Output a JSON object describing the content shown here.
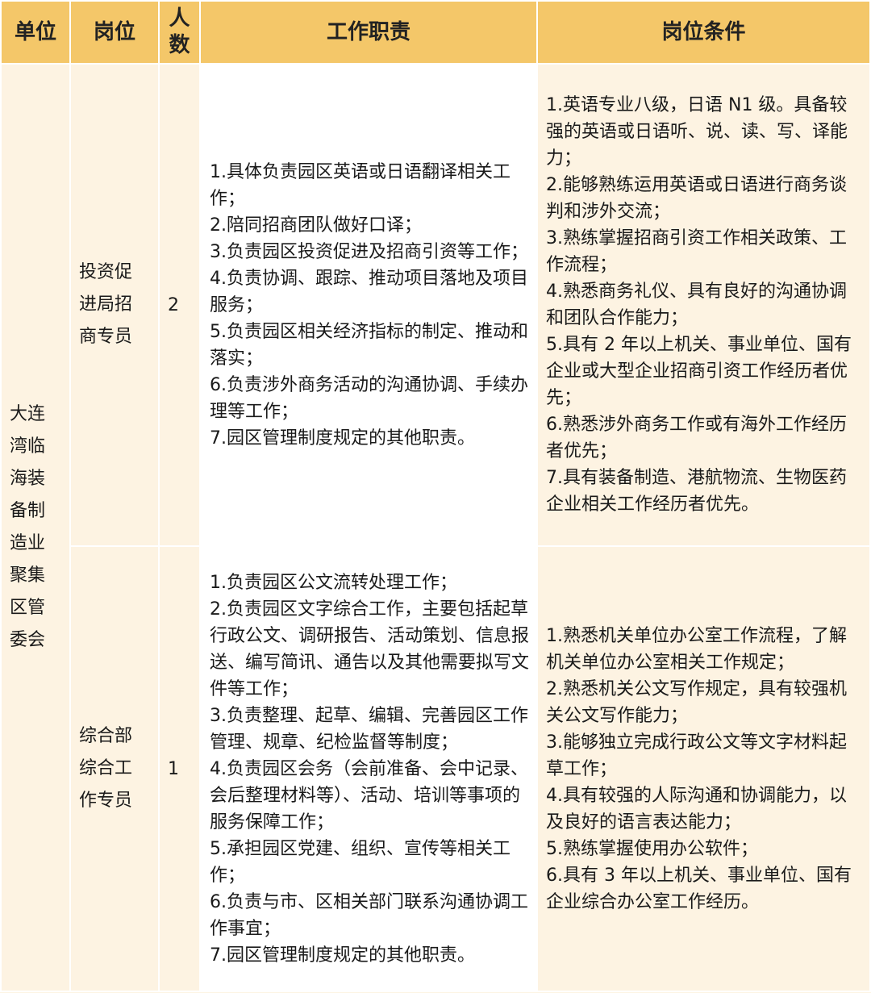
{
  "headers": {
    "unit": "单位",
    "post": "岗位",
    "count": "人数",
    "duties": "工作职责",
    "conditions": "岗位条件"
  },
  "unit": "大连湾临海装备制造业聚集区管委会",
  "rows": [
    {
      "post": "投资促进局招商专员",
      "count": "2",
      "duties": [
        "1.具体负责园区英语或日语翻译相关工作；",
        "2.陪同招商团队做好口译；",
        "3.负责园区投资促进及招商引资等工作；",
        "4.负责协调、跟踪、推动项目落地及项目服务；",
        "5.负责园区相关经济指标的制定、推动和落实；",
        "6.负责涉外商务活动的沟通协调、手续办理等工作；",
        "7.园区管理制度规定的其他职责。"
      ],
      "conditions": [
        "1.英语专业八级，日语 N1 级。具备较强的英语或日语听、说、读、写、译能力；",
        "2.能够熟练运用英语或日语进行商务谈判和涉外交流；",
        "3.熟练掌握招商引资工作相关政策、工作流程；",
        "4.熟悉商务礼仪、具有良好的沟通协调和团队合作能力；",
        "5.具有 2 年以上机关、事业单位、国有企业或大型企业招商引资工作经历者优先；",
        "6.熟悉涉外商务工作或有海外工作经历者优先；",
        "7.具有装备制造、港航物流、生物医药企业相关工作经历者优先。"
      ]
    },
    {
      "post": "综合部综合工作专员",
      "count": "1",
      "duties": [
        "1.负责园区公文流转处理工作；",
        "2.负责园区文字综合工作，主要包括起草行政公文、调研报告、活动策划、信息报送、编写简讯、通告以及其他需要拟写文件等工作；",
        "3.负责整理、起草、编辑、完善园区工作管理、规章、纪检监督等制度；",
        "4.负责园区会务（会前准备、会中记录、会后整理材料等）、活动、培训等事项的服务保障工作；",
        "5.承担园区党建、组织、宣传等相关工作；",
        "6.负责与市、区相关部门联系沟通协调工作事宜；",
        "7.园区管理制度规定的其他职责。"
      ],
      "conditions": [
        "1.熟悉机关单位办公室工作流程，了解机关单位办公室相关工作规定；",
        "2.熟悉机关公文写作规定，具有较强机关公文写作能力；",
        "3.能够独立完成行政公文等文字材料起草工作；",
        "4.具有较强的人际沟通和协调能力，以及良好的语言表达能力；",
        "5.熟练掌握使用办公软件；",
        "6.具有 3 年以上机关、事业单位、国有企业综合办公室工作经历。"
      ]
    }
  ]
}
